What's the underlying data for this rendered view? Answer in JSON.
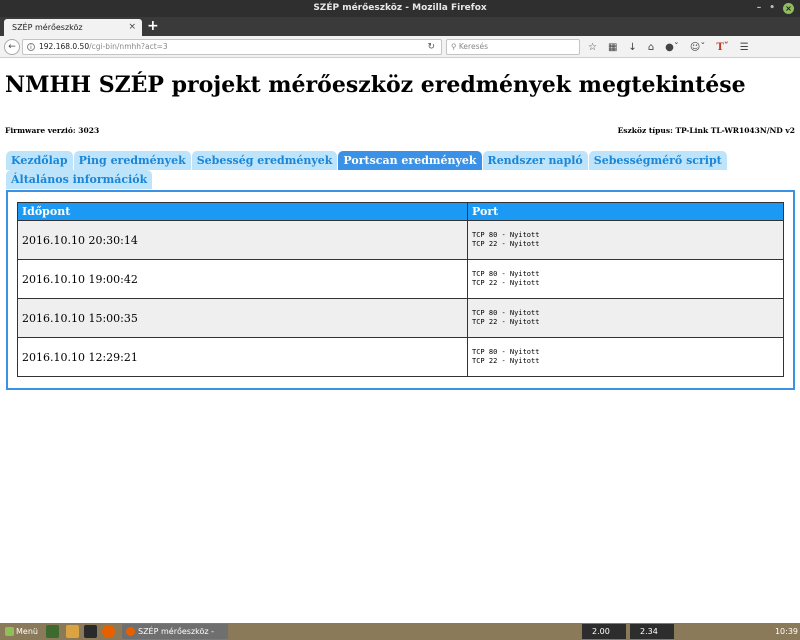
{
  "window": {
    "title": "SZÉP mérőeszköz - Mozilla Firefox"
  },
  "browser": {
    "tab_title": "SZÉP mérőeszköz",
    "tab_close": "×",
    "new_tab": "+",
    "url_host": "192.168.0.50",
    "url_path": "/cgi-bin/nmhh?act=3",
    "search_placeholder": "Keresés"
  },
  "page": {
    "title": "NMHH SZÉP projekt mérőeszköz eredmények megtekintése",
    "firmware": "Firmware verzió: 3023",
    "device": "Eszköz típus: TP-Link TL-WR1043N/ND v2",
    "tabs": [
      {
        "label": "Kezdőlap"
      },
      {
        "label": "Ping eredmények"
      },
      {
        "label": "Sebesség eredmények"
      },
      {
        "label": "Portscan eredmények"
      },
      {
        "label": "Rendszer napló"
      },
      {
        "label": "Sebességmérő script"
      },
      {
        "label": "Általános információk"
      }
    ],
    "active_tab": "Portscan eredmények",
    "table": {
      "headers": [
        "Időpont",
        "Port"
      ],
      "rows": [
        {
          "time": "2016.10.10 20:30:14",
          "port1": "TCP 80 - Nyitott",
          "port2": "TCP 22 - Nyitott"
        },
        {
          "time": "2016.10.10 19:00:42",
          "port1": "TCP 80 - Nyitott",
          "port2": "TCP 22 - Nyitott"
        },
        {
          "time": "2016.10.10 15:00:35",
          "port1": "TCP 80 - Nyitott",
          "port2": "TCP 22 - Nyitott"
        },
        {
          "time": "2016.10.10 12:29:21",
          "port1": "TCP 80 - Nyitott",
          "port2": "TCP 22 - Nyitott"
        }
      ]
    }
  },
  "taskbar": {
    "menu": "Menü",
    "firefox_task": "SZÉP mérőeszköz - M...",
    "cpu1": "2.00 GHz",
    "cpu2": "2.34 GHz",
    "clock": "10:39"
  },
  "colors": {
    "tab_bg": "#bde4fb",
    "tab_text": "#1a86d8",
    "tab_active": "#3a91e6",
    "table_header": "#1a9af4"
  }
}
